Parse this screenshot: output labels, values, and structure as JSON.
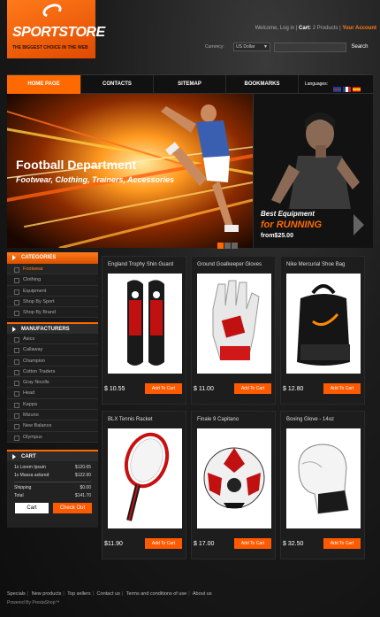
{
  "brand": {
    "name": "SPORTSTORE",
    "tagline": "THE BIGGEST CHOICE IN THE WEB"
  },
  "top": {
    "welcome": "Welcome, Log in",
    "cart_label": "Cart:",
    "cart_value": "2 Products",
    "account": "Your Account"
  },
  "currency": {
    "label": "Currency:",
    "selected": "US Dollar"
  },
  "search": {
    "button": "Search",
    "placeholder": ""
  },
  "nav": [
    "HOME PAGE",
    "CONTACTS",
    "SITEMAP",
    "BOOKMARKS"
  ],
  "languages_label": "Languages:",
  "colors": {
    "accent": "#ff6a00",
    "panel": "#1e1e1e"
  },
  "hero": {
    "title": "Football Department",
    "subtitle": "Footwear, Clothing, Trainers, Accessories",
    "side_line1": "Best Equipment",
    "side_line2": "for RUNNING",
    "side_line3": "from$25.00"
  },
  "categories": {
    "title": "CATEGORIES",
    "items": [
      "Footwear",
      "Clothing",
      "Equipment",
      "Shop By Sport",
      "Shop By Brand"
    ]
  },
  "manufacturers": {
    "title": "MANUFACTURERS",
    "items": [
      "Asics",
      "Callaway",
      "Champion",
      "Cotton Traders",
      "Gray Nicolls",
      "Head",
      "Kappa",
      "Mizuno",
      "New Balance",
      "Olympus"
    ]
  },
  "cart": {
    "title": "CART",
    "items": [
      {
        "label": "1x  Lorem Ipsum",
        "price": "$120.65"
      },
      {
        "label": "1x  Massa aolured",
        "price": "$122.90"
      }
    ],
    "shipping_label": "Shipping",
    "shipping": "$0.00",
    "total_label": "Total",
    "total": "$141.70",
    "cart_button": "Cart",
    "checkout_button": "Check Out"
  },
  "products": [
    {
      "name": "England Trophy Shin Guard",
      "price": "$ 10.55",
      "add": "Add To Cart"
    },
    {
      "name": "Ground Goalkeeper Gloves",
      "price": "$ 11.00",
      "add": "Add To Cart"
    },
    {
      "name": "Nike Mercurial Shoe Bag",
      "price": "$ 12.80",
      "add": "Add To Cart"
    },
    {
      "name": "BLX Tennis Racket",
      "price": "$11.90",
      "add": "Add To Cart"
    },
    {
      "name": "Finale 9 Capitano",
      "price": "$ 17.00",
      "add": "Add To Cart"
    },
    {
      "name": "Boxing Glove - 14oz",
      "price": "$ 32.50",
      "add": "Add To Cart"
    }
  ],
  "footer": {
    "links": [
      "Specials",
      "New products",
      "Top sellers",
      "Contact us",
      "Terms and conditions of use",
      "About us"
    ],
    "powered": "Powered By PrestaShop™"
  }
}
